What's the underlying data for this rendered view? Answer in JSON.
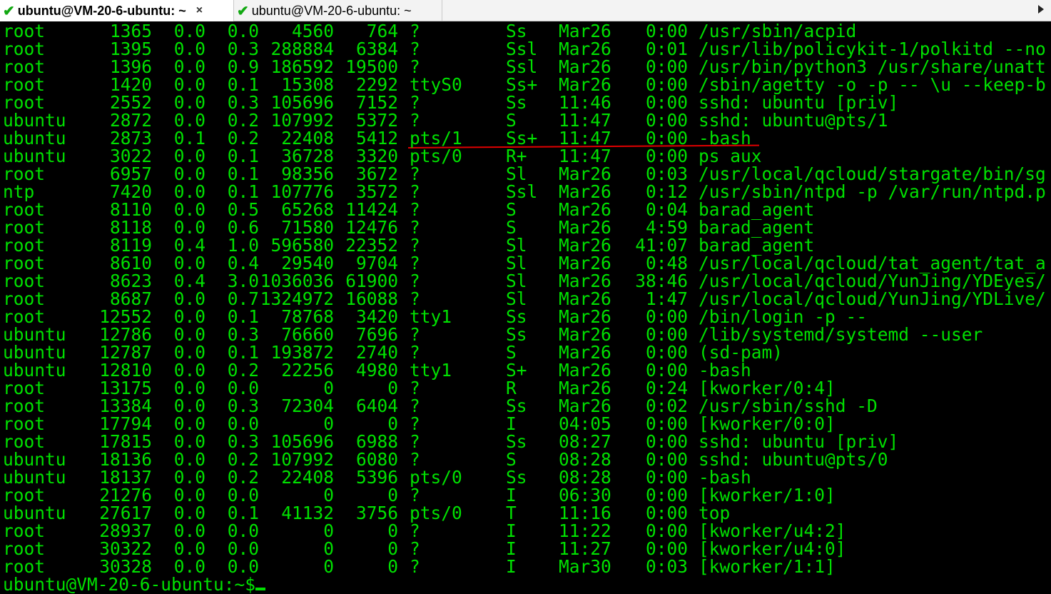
{
  "tabs": [
    {
      "title": "ubuntu@VM-20-6-ubuntu: ~",
      "close": "×",
      "active": true
    },
    {
      "title": "ubuntu@VM-20-6-ubuntu: ~",
      "active": false
    }
  ],
  "colors": {
    "text": "#00e000",
    "background": "#000000",
    "annotation": "#e00000",
    "tab_check": "#12a812"
  },
  "terminal": {
    "rows": [
      [
        "root",
        "1365",
        "0.0",
        "0.0",
        "4560",
        "764",
        "?",
        "Ss",
        "Mar26",
        "0:00",
        "/usr/sbin/acpid"
      ],
      [
        "root",
        "1395",
        "0.0",
        "0.3",
        "288884",
        "6384",
        "?",
        "Ssl",
        "Mar26",
        "0:01",
        "/usr/lib/policykit-1/polkitd --no"
      ],
      [
        "root",
        "1396",
        "0.0",
        "0.9",
        "186592",
        "19500",
        "?",
        "Ssl",
        "Mar26",
        "0:00",
        "/usr/bin/python3 /usr/share/unatt"
      ],
      [
        "root",
        "1420",
        "0.0",
        "0.1",
        "15308",
        "2292",
        "ttyS0",
        "Ss+",
        "Mar26",
        "0:00",
        "/sbin/agetty -o -p -- \\u --keep-b"
      ],
      [
        "root",
        "2552",
        "0.0",
        "0.3",
        "105696",
        "7152",
        "?",
        "Ss",
        "11:46",
        "0:00",
        "sshd: ubuntu [priv]"
      ],
      [
        "ubuntu",
        "2872",
        "0.0",
        "0.2",
        "107992",
        "5372",
        "?",
        "S",
        "11:47",
        "0:00",
        "sshd: ubuntu@pts/1"
      ],
      [
        "ubuntu",
        "2873",
        "0.1",
        "0.2",
        "22408",
        "5412",
        "pts/1",
        "Ss+",
        "11:47",
        "0:00",
        "-bash"
      ],
      [
        "ubuntu",
        "3022",
        "0.0",
        "0.1",
        "36728",
        "3320",
        "pts/0",
        "R+",
        "11:47",
        "0:00",
        "ps aux"
      ],
      [
        "root",
        "6957",
        "0.0",
        "0.1",
        "98356",
        "3672",
        "?",
        "Sl",
        "Mar26",
        "0:03",
        "/usr/local/qcloud/stargate/bin/sg"
      ],
      [
        "ntp",
        "7420",
        "0.0",
        "0.1",
        "107776",
        "3572",
        "?",
        "Ssl",
        "Mar26",
        "0:12",
        "/usr/sbin/ntpd -p /var/run/ntpd.p"
      ],
      [
        "root",
        "8110",
        "0.0",
        "0.5",
        "65268",
        "11424",
        "?",
        "S",
        "Mar26",
        "0:04",
        "barad_agent"
      ],
      [
        "root",
        "8118",
        "0.0",
        "0.6",
        "71580",
        "12476",
        "?",
        "S",
        "Mar26",
        "4:59",
        "barad_agent"
      ],
      [
        "root",
        "8119",
        "0.4",
        "1.0",
        "596580",
        "22352",
        "?",
        "Sl",
        "Mar26",
        "41:07",
        "barad_agent"
      ],
      [
        "root",
        "8610",
        "0.0",
        "0.4",
        "29540",
        "9704",
        "?",
        "Sl",
        "Mar26",
        "0:48",
        "/usr/local/qcloud/tat_agent/tat_a"
      ],
      [
        "root",
        "8623",
        "0.4",
        "3.0",
        "1036036",
        "61900",
        "?",
        "Sl",
        "Mar26",
        "38:46",
        "/usr/local/qcloud/YunJing/YDEyes/"
      ],
      [
        "root",
        "8687",
        "0.0",
        "0.7",
        "1324972",
        "16088",
        "?",
        "Sl",
        "Mar26",
        "1:47",
        "/usr/local/qcloud/YunJing/YDLive/"
      ],
      [
        "root",
        "12552",
        "0.0",
        "0.1",
        "78768",
        "3420",
        "tty1",
        "Ss",
        "Mar26",
        "0:00",
        "/bin/login -p --"
      ],
      [
        "ubuntu",
        "12786",
        "0.0",
        "0.3",
        "76660",
        "7696",
        "?",
        "Ss",
        "Mar26",
        "0:00",
        "/lib/systemd/systemd --user"
      ],
      [
        "ubuntu",
        "12787",
        "0.0",
        "0.1",
        "193872",
        "2740",
        "?",
        "S",
        "Mar26",
        "0:00",
        "(sd-pam)"
      ],
      [
        "ubuntu",
        "12810",
        "0.0",
        "0.2",
        "22256",
        "4980",
        "tty1",
        "S+",
        "Mar26",
        "0:00",
        "-bash"
      ],
      [
        "root",
        "13175",
        "0.0",
        "0.0",
        "0",
        "0",
        "?",
        "R",
        "Mar26",
        "0:24",
        "[kworker/0:4]"
      ],
      [
        "root",
        "13384",
        "0.0",
        "0.3",
        "72304",
        "6404",
        "?",
        "Ss",
        "Mar26",
        "0:02",
        "/usr/sbin/sshd -D"
      ],
      [
        "root",
        "17794",
        "0.0",
        "0.0",
        "0",
        "0",
        "?",
        "I",
        "04:05",
        "0:00",
        "[kworker/0:0]"
      ],
      [
        "root",
        "17815",
        "0.0",
        "0.3",
        "105696",
        "6988",
        "?",
        "Ss",
        "08:27",
        "0:00",
        "sshd: ubuntu [priv]"
      ],
      [
        "ubuntu",
        "18136",
        "0.0",
        "0.2",
        "107992",
        "6080",
        "?",
        "S",
        "08:28",
        "0:00",
        "sshd: ubuntu@pts/0"
      ],
      [
        "ubuntu",
        "18137",
        "0.0",
        "0.2",
        "22408",
        "5396",
        "pts/0",
        "Ss",
        "08:28",
        "0:00",
        "-bash"
      ],
      [
        "root",
        "21276",
        "0.0",
        "0.0",
        "0",
        "0",
        "?",
        "I",
        "06:30",
        "0:00",
        "[kworker/1:0]"
      ],
      [
        "ubuntu",
        "27617",
        "0.0",
        "0.1",
        "41132",
        "3756",
        "pts/0",
        "T",
        "11:16",
        "0:00",
        "top"
      ],
      [
        "root",
        "28937",
        "0.0",
        "0.0",
        "0",
        "0",
        "?",
        "I",
        "11:22",
        "0:00",
        "[kworker/u4:2]"
      ],
      [
        "root",
        "30322",
        "0.0",
        "0.0",
        "0",
        "0",
        "?",
        "I",
        "11:27",
        "0:00",
        "[kworker/u4:0]"
      ],
      [
        "root",
        "30328",
        "0.0",
        "0.0",
        "0",
        "0",
        "?",
        "I",
        "Mar30",
        "0:03",
        "[kworker/1:1]"
      ]
    ],
    "prompt": "ubuntu@VM-20-6-ubuntu:~$"
  }
}
